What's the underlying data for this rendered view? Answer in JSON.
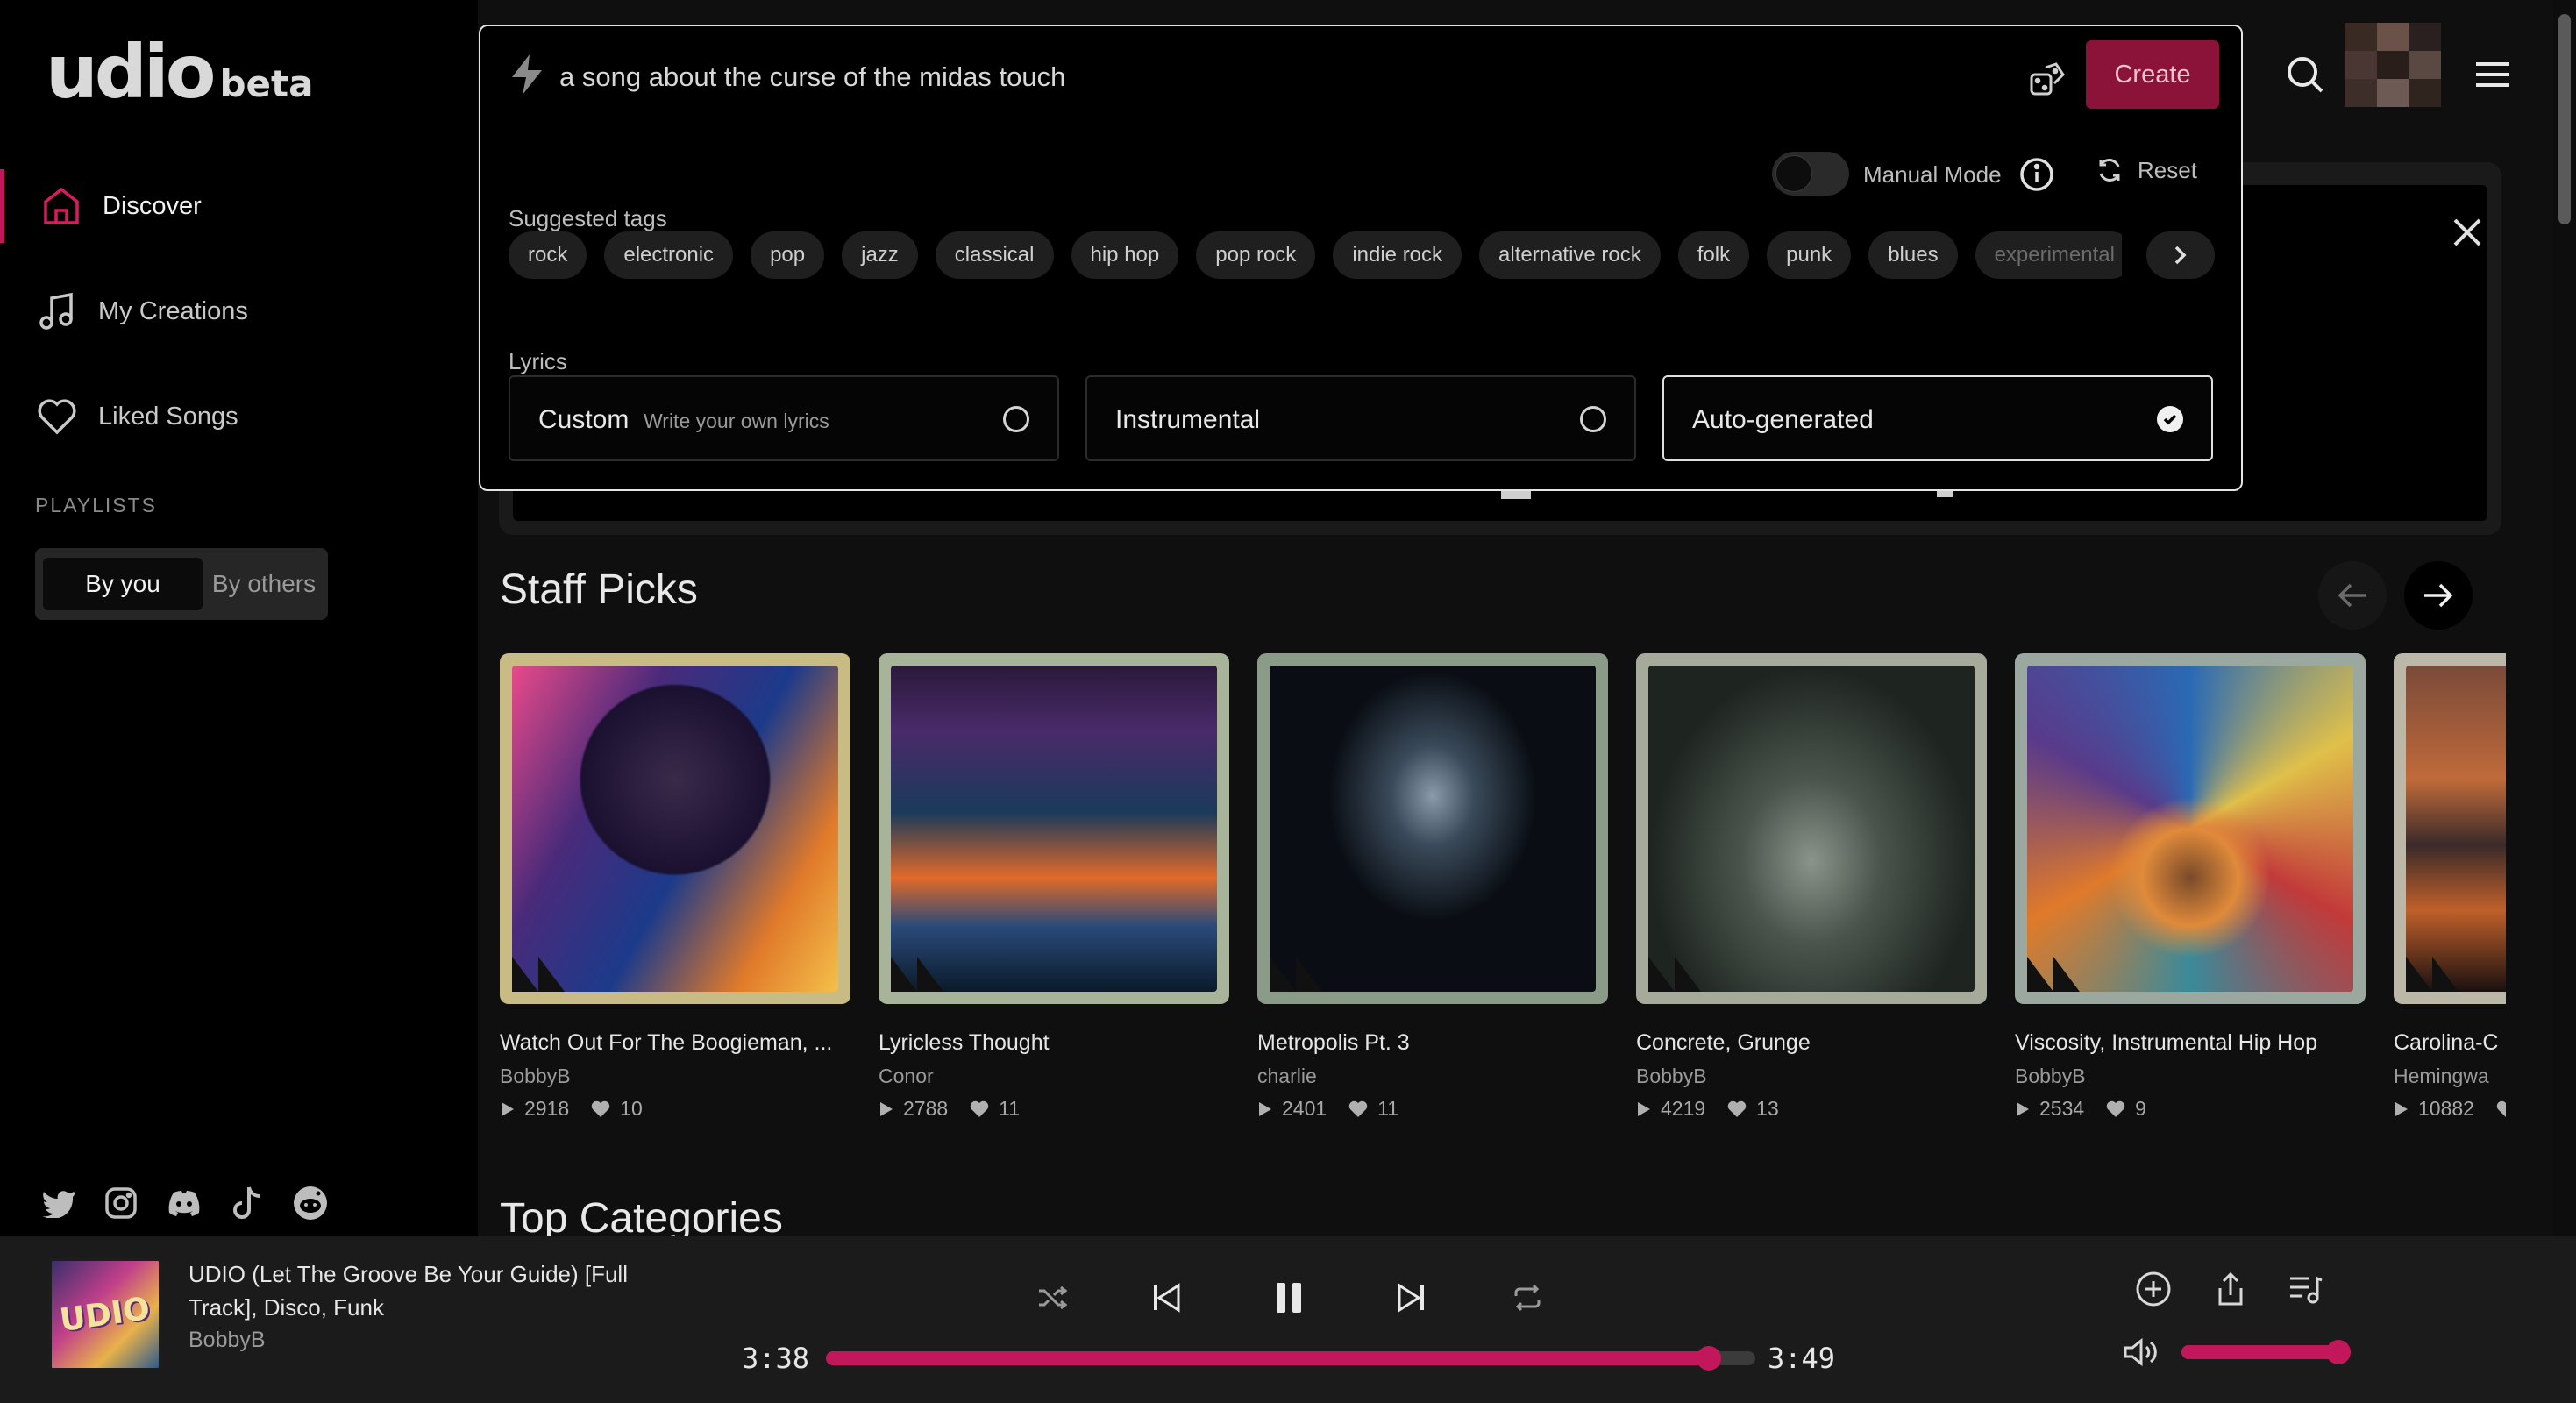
{
  "brand": {
    "name": "udio",
    "tag": "beta"
  },
  "sidebar": {
    "nav": [
      {
        "label": "Discover",
        "active": true
      },
      {
        "label": "My Creations",
        "active": false
      },
      {
        "label": "Liked Songs",
        "active": false
      }
    ],
    "playlists_label": "PLAYLISTS",
    "playlist_tabs": [
      {
        "label": "By you",
        "active": true
      },
      {
        "label": "By others",
        "active": false
      }
    ],
    "socials": [
      "twitter-icon",
      "instagram-icon",
      "discord-icon",
      "tiktok-icon",
      "reddit-icon"
    ]
  },
  "prompt": {
    "value": "a song about the curse of the midas touch",
    "create_label": "Create",
    "manual_mode_label": "Manual Mode",
    "manual_mode_on": false,
    "reset_label": "Reset",
    "suggested_tags_label": "Suggested tags",
    "tags": [
      "rock",
      "electronic",
      "pop",
      "jazz",
      "classical",
      "hip hop",
      "pop rock",
      "indie rock",
      "alternative rock",
      "folk",
      "punk",
      "blues",
      "experimental"
    ],
    "lyrics_label": "Lyrics",
    "lyrics_options": [
      {
        "title": "Custom",
        "subtitle": "Write your own lyrics",
        "selected": false
      },
      {
        "title": "Instrumental",
        "subtitle": "",
        "selected": false
      },
      {
        "title": "Auto-generated",
        "subtitle": "",
        "selected": true
      }
    ]
  },
  "staff_picks": {
    "title": "Staff Picks",
    "cards": [
      {
        "title": "Watch Out For The Boogieman, ...",
        "artist": "BobbyB",
        "plays": "2918",
        "likes": "10"
      },
      {
        "title": "Lyricless Thought",
        "artist": "Conor",
        "plays": "2788",
        "likes": "11"
      },
      {
        "title": "Metropolis Pt. 3",
        "artist": "charlie",
        "plays": "2401",
        "likes": "11"
      },
      {
        "title": "Concrete, Grunge",
        "artist": "BobbyB",
        "plays": "4219",
        "likes": "13"
      },
      {
        "title": "Viscosity, Instrumental Hip Hop",
        "artist": "BobbyB",
        "plays": "2534",
        "likes": "9"
      },
      {
        "title": "Carolina-C",
        "artist": "Hemingwa",
        "plays": "10882",
        "likes": ""
      }
    ]
  },
  "top_categories": {
    "title": "Top Categories"
  },
  "player": {
    "cover_text": "UDIO",
    "title": "UDIO (Let The Groove Be Your Guide) [Full Track], Disco, Funk",
    "artist": "BobbyB",
    "elapsed": "3:38",
    "duration": "3:49",
    "progress": 0.95,
    "volume": 0.96
  },
  "colors": {
    "accent": "#c2185b",
    "create_bg": "#8b1239"
  }
}
